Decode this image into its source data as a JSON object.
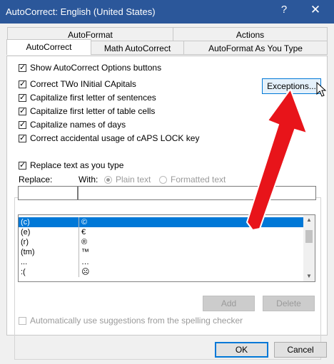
{
  "window": {
    "title": "AutoCorrect: English (United States)",
    "help_icon": "?",
    "close_icon": "✕"
  },
  "tabs": {
    "back_row": [
      "AutoFormat",
      "Actions"
    ],
    "front_row": [
      "AutoCorrect",
      "Math AutoCorrect",
      "AutoFormat As You Type"
    ],
    "active": "AutoCorrect"
  },
  "options": {
    "show_buttons": "Show AutoCorrect Options buttons",
    "correct_two_initial": "Correct TWo INitial CApitals",
    "capitalize_sentences": "Capitalize first letter of sentences",
    "capitalize_table_cells": "Capitalize first letter of table cells",
    "capitalize_days": "Capitalize names of days",
    "correct_caps_lock": "Correct accidental usage of cAPS LOCK key"
  },
  "exceptions_label": "Exceptions...",
  "replace_group": {
    "checkbox_label": "Replace text as you type",
    "replace_label": "Replace:",
    "with_label": "With:",
    "plain_text": "Plain text",
    "formatted_text": "Formatted text",
    "replace_value": "",
    "with_value": ""
  },
  "entries": [
    {
      "replace": "(c)",
      "with": "©"
    },
    {
      "replace": "(e)",
      "with": "€"
    },
    {
      "replace": "(r)",
      "with": "®"
    },
    {
      "replace": "(tm)",
      "with": "™"
    },
    {
      "replace": "...",
      "with": "…"
    },
    {
      "replace": ":(",
      "with": "☹"
    }
  ],
  "selected_entry": 0,
  "buttons": {
    "add": "Add",
    "delete": "Delete",
    "ok": "OK",
    "cancel": "Cancel"
  },
  "spelling_suggestions": "Automatically use suggestions from the spelling checker",
  "colors": {
    "title_bar": "#2b579a",
    "selection": "#0078d7",
    "arrow": "#e8141a"
  }
}
